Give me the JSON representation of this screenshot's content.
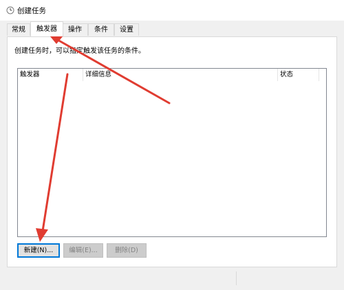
{
  "window": {
    "title": "创建任务",
    "app_icon": "clock-icon"
  },
  "tabs": [
    {
      "label": "常规",
      "active": false
    },
    {
      "label": "触发器",
      "active": true
    },
    {
      "label": "操作",
      "active": false
    },
    {
      "label": "条件",
      "active": false
    },
    {
      "label": "设置",
      "active": false
    }
  ],
  "triggers": {
    "description": "创建任务时，可以指定触发该任务的条件。",
    "columns": [
      "触发器",
      "详细信息",
      "状态"
    ],
    "rows": []
  },
  "buttons": {
    "new": "新建(N)...",
    "edit": "编辑(E)...",
    "delete": "删除(D)"
  },
  "annotation": {
    "arrow_color": "#e03c31"
  }
}
